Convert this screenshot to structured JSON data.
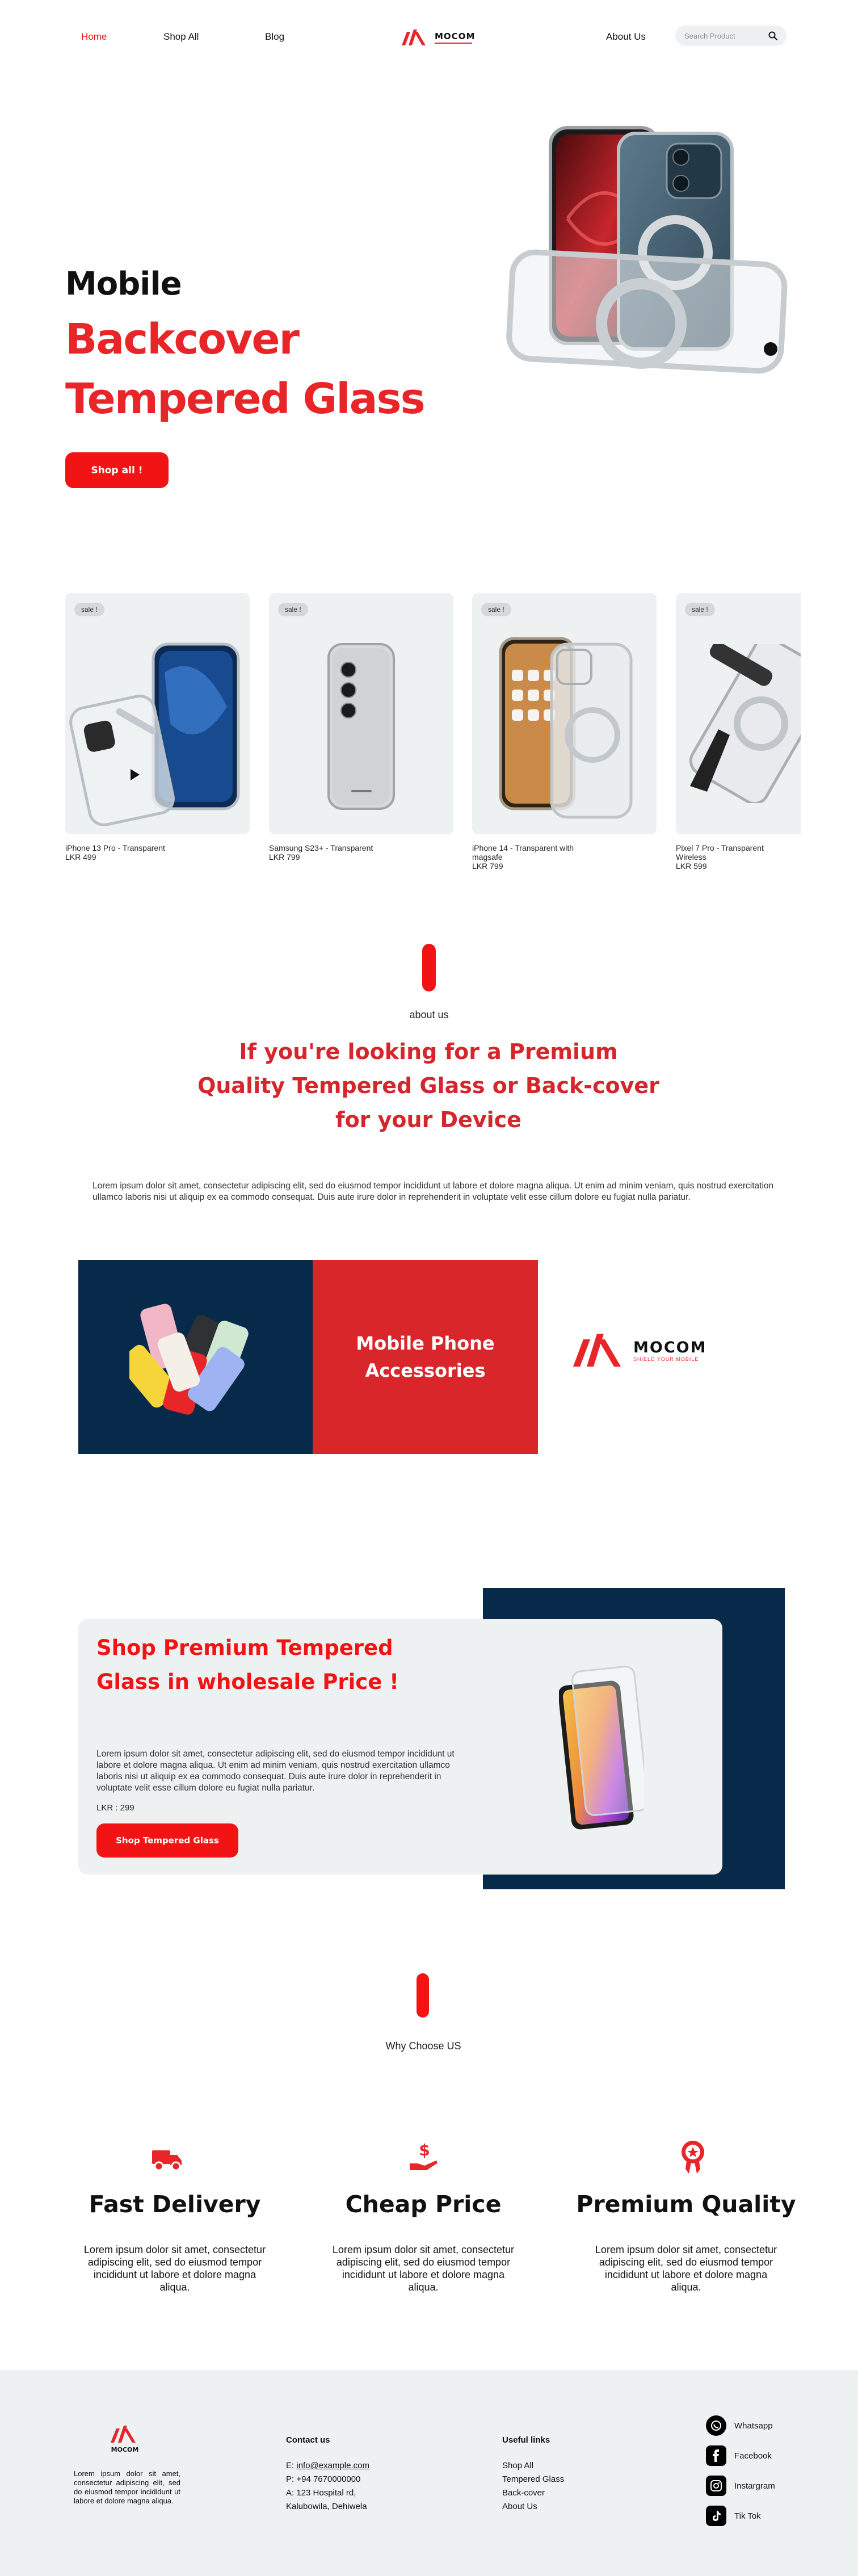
{
  "nav": {
    "home": "Home",
    "shop_all": "Shop All",
    "blog": "Blog",
    "brand": "MOCOM",
    "about": "About Us",
    "search_placeholder": "Search Product"
  },
  "hero": {
    "line1": "Mobile",
    "line2": "Backcover",
    "line3": "Tempered Glass",
    "cta": "Shop all !"
  },
  "products": [
    {
      "badge": "sale !",
      "name": "iPhone 13 Pro - Transparent",
      "price": "LKR 499"
    },
    {
      "badge": "sale !",
      "name": "Samsung S23+ - Transparent",
      "price": "LKR 799"
    },
    {
      "badge": "sale !",
      "name": "iPhone 14 - Transparent with magsafe",
      "price": "LKR 799"
    },
    {
      "badge": "sale !",
      "name": "Pixel 7 Pro - Transparent Wireless",
      "price": "LKR 599"
    }
  ],
  "about": {
    "label": "about us",
    "heading": "If you're looking for a Premium Quality Tempered Glass or Back-cover for your Device",
    "body": "Lorem ipsum dolor sit amet, consectetur adipiscing elit, sed do eiusmod tempor incididunt ut labore et dolore magna aliqua. Ut enim ad minim veniam, quis nostrud exercitation ullamco laboris nisi ut aliquip ex ea commodo consequat. Duis aute irure dolor in reprehenderit in voluptate velit esse cillum dolore eu fugiat nulla pariatur."
  },
  "banner": {
    "title": "Mobile Phone Accessories",
    "brand": "MOCOM",
    "tagline": "SHIELD YOUR MOBILE"
  },
  "wholesale": {
    "title": "Shop Premium Tempered Glass in wholesale Price !",
    "body": "Lorem ipsum dolor sit amet, consectetur adipiscing elit, sed do eiusmod tempor incididunt ut labore et dolore magna aliqua. Ut enim ad minim veniam, quis nostrud exercitation ullamco laboris nisi ut aliquip ex ea commodo consequat. Duis aute irure dolor in reprehenderit in voluptate velit esse cillum dolore eu fugiat nulla pariatur.",
    "price": "LKR : 299",
    "cta": "Shop Tempered Glass"
  },
  "why": {
    "label": "Why Choose US",
    "features": [
      {
        "icon": "truck-icon",
        "title": "Fast Delivery",
        "text": "Lorem ipsum dolor sit amet, consectetur adipiscing elit, sed do eiusmod tempor incididunt ut labore et dolore magna aliqua."
      },
      {
        "icon": "hand-dollar-icon",
        "title": "Cheap Price",
        "text": "Lorem ipsum dolor sit amet, consectetur adipiscing elit, sed do eiusmod tempor incididunt ut labore et dolore magna aliqua."
      },
      {
        "icon": "award-medal-icon",
        "title": "Premium Quality",
        "text": "Lorem ipsum dolor sit amet, consectetur adipiscing elit, sed do eiusmod tempor incididunt ut labore et dolore magna aliqua."
      }
    ]
  },
  "footer": {
    "brand": "MOCOM",
    "about": "Lorem ipsum dolor sit amet, consectetur adipiscing elit, sed do eiusmod tempor incididunt ut labore et dolore magna aliqua.",
    "contact_head": "Contact us",
    "email_prefix": "E:",
    "email": "info@example.com",
    "phone": "P: +94 7670000000",
    "address1": "A: 123 Hospital rd,",
    "address2": "Kalubowila, Dehiwela",
    "links_head": "Useful links",
    "links": [
      "Shop All",
      "Tempered Glass",
      "Back-cover",
      "About Us"
    ],
    "social": [
      {
        "icon": "whatsapp-icon",
        "label": "Whatsapp"
      },
      {
        "icon": "facebook-icon",
        "label": "Facebook"
      },
      {
        "icon": "instagram-icon",
        "label": "Instargram"
      },
      {
        "icon": "tiktok-icon",
        "label": "Tik Tok"
      }
    ]
  },
  "colors": {
    "accent": "#f21414",
    "heading_red": "#d4262c",
    "navy": "#072a4a",
    "card_bg": "#edf1f2"
  }
}
